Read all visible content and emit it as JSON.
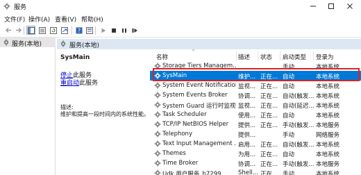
{
  "window": {
    "title": "服务"
  },
  "menu": [
    "文件(F)",
    "操作(A)",
    "查看(V)",
    "帮助(H)"
  ],
  "tree": {
    "root_label": "服务(本地)"
  },
  "main": {
    "header": "服务(本地)"
  },
  "details": {
    "service_name": "SysMain",
    "stop_link": "停止",
    "stop_suffix": "此服务",
    "restart_link": "重启动",
    "restart_suffix": "此服务",
    "desc_label": "描述:",
    "desc_text": "维护和提高一段时间内的系统性能。"
  },
  "list": {
    "columns": {
      "name": "名称",
      "desc": "描述",
      "status": "状态",
      "startup": "启动类型",
      "logon": "登录为"
    },
    "rows": [
      {
        "name": "Storage Tiers Managem...",
        "desc": "",
        "status": "",
        "startup": "手动",
        "logon": "本地系统"
      },
      {
        "name": "SysMain",
        "desc": "维护...",
        "status": "正在...",
        "startup": "自动",
        "logon": "本地系统",
        "selected": true
      },
      {
        "name": "System Event Notification...",
        "desc": "监视...",
        "status": "正在...",
        "startup": "自动",
        "logon": "本地系统"
      },
      {
        "name": "System Events Broker",
        "desc": "协调...",
        "status": "正在...",
        "startup": "自动(触发...",
        "logon": "本地系统"
      },
      {
        "name": "System Guard 运行时监视...",
        "desc": "监视...",
        "status": "正在...",
        "startup": "自动(延迟...",
        "logon": "本地系统"
      },
      {
        "name": "Task Scheduler",
        "desc": "使用...",
        "status": "正在...",
        "startup": "自动",
        "logon": "本地系统"
      },
      {
        "name": "TCP/IP NetBIOS Helper",
        "desc": "提供...",
        "status": "正在...",
        "startup": "手动(触发...",
        "logon": "本地服务"
      },
      {
        "name": "Telephony",
        "desc": "提供...",
        "status": "",
        "startup": "手动",
        "logon": "网络服务"
      },
      {
        "name": "Text Input Management ...",
        "desc": "启用...",
        "status": "正在...",
        "startup": "自动(触发...",
        "logon": "本地系统"
      },
      {
        "name": "Themes",
        "desc": "为用...",
        "status": "正在...",
        "startup": "自动",
        "logon": "本地系统"
      },
      {
        "name": "Time Broker",
        "desc": "协调...",
        "status": "正在...",
        "startup": "手动(触发...",
        "logon": "本地服务"
      },
      {
        "name": "Udk 用户服务_b7299",
        "desc": "Shell...",
        "status": "正在...",
        "startup": "手动",
        "logon": "本地系统"
      }
    ]
  },
  "colors": {
    "selection": "#0078d7",
    "highlight_box": "#e02020",
    "header_bg": "#dde7f3"
  }
}
